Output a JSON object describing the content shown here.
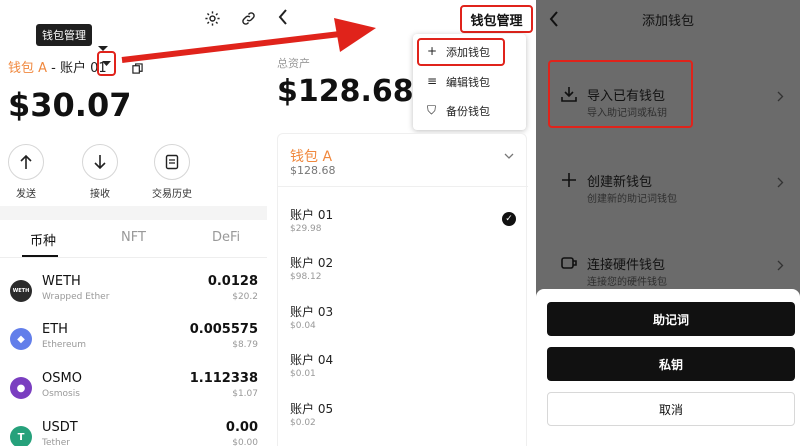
{
  "panel1": {
    "tooltip": "钱包管理",
    "wallet_name": "钱包 A",
    "account_suffix": " - 账户 01",
    "balance": "$30.07",
    "actions": [
      "发送",
      "接收",
      "交易历史"
    ],
    "tabs": [
      "币种",
      "NFT",
      "DeFi"
    ],
    "tokens": [
      {
        "symbol": "WETH",
        "name": "Wrapped Ether",
        "amount": "0.0128",
        "usd": "$20.2",
        "icon_label": "WETH",
        "color": "#2b2b2b"
      },
      {
        "symbol": "ETH",
        "name": "Ethereum",
        "amount": "0.005575",
        "usd": "$8.79",
        "icon_label": "◆",
        "color": "#627eea"
      },
      {
        "symbol": "OSMO",
        "name": "Osmosis",
        "amount": "1.112338",
        "usd": "$1.07",
        "icon_label": "●",
        "color": "#7a3ec0"
      },
      {
        "symbol": "USDT",
        "name": "Tether",
        "amount": "0.00",
        "usd": "$0.00",
        "icon_label": "T",
        "color": "#26a17b"
      }
    ]
  },
  "panel2": {
    "title": "钱包管理",
    "total_label": "总资产",
    "balance": "$128.68",
    "menu": [
      {
        "icon": "+",
        "label": "添加钱包"
      },
      {
        "icon": "≡",
        "label": "编辑钱包"
      },
      {
        "icon": "⛉",
        "label": "备份钱包"
      }
    ],
    "wallet_name": "钱包 A",
    "wallet_balance": "$128.68",
    "accounts": [
      {
        "name": "账户 01",
        "balance": "$29.98",
        "selected": true
      },
      {
        "name": "账户 02",
        "balance": "$98.12"
      },
      {
        "name": "账户 03",
        "balance": "$0.04"
      },
      {
        "name": "账户 04",
        "balance": "$0.01"
      },
      {
        "name": "账户 05",
        "balance": "$0.02"
      }
    ]
  },
  "panel3": {
    "title": "添加钱包",
    "options": [
      {
        "title": "导入已有钱包",
        "subtitle": "导入助记词或私钥"
      },
      {
        "title": "创建新钱包",
        "subtitle": "创建新的助记词钱包"
      },
      {
        "title": "连接硬件钱包",
        "subtitle": "连接您的硬件钱包"
      }
    ],
    "sheet_buttons": [
      "助记词",
      "私钥",
      "取消"
    ]
  },
  "colors": {
    "accent": "#f0883e",
    "highlight": "#e0231b"
  }
}
